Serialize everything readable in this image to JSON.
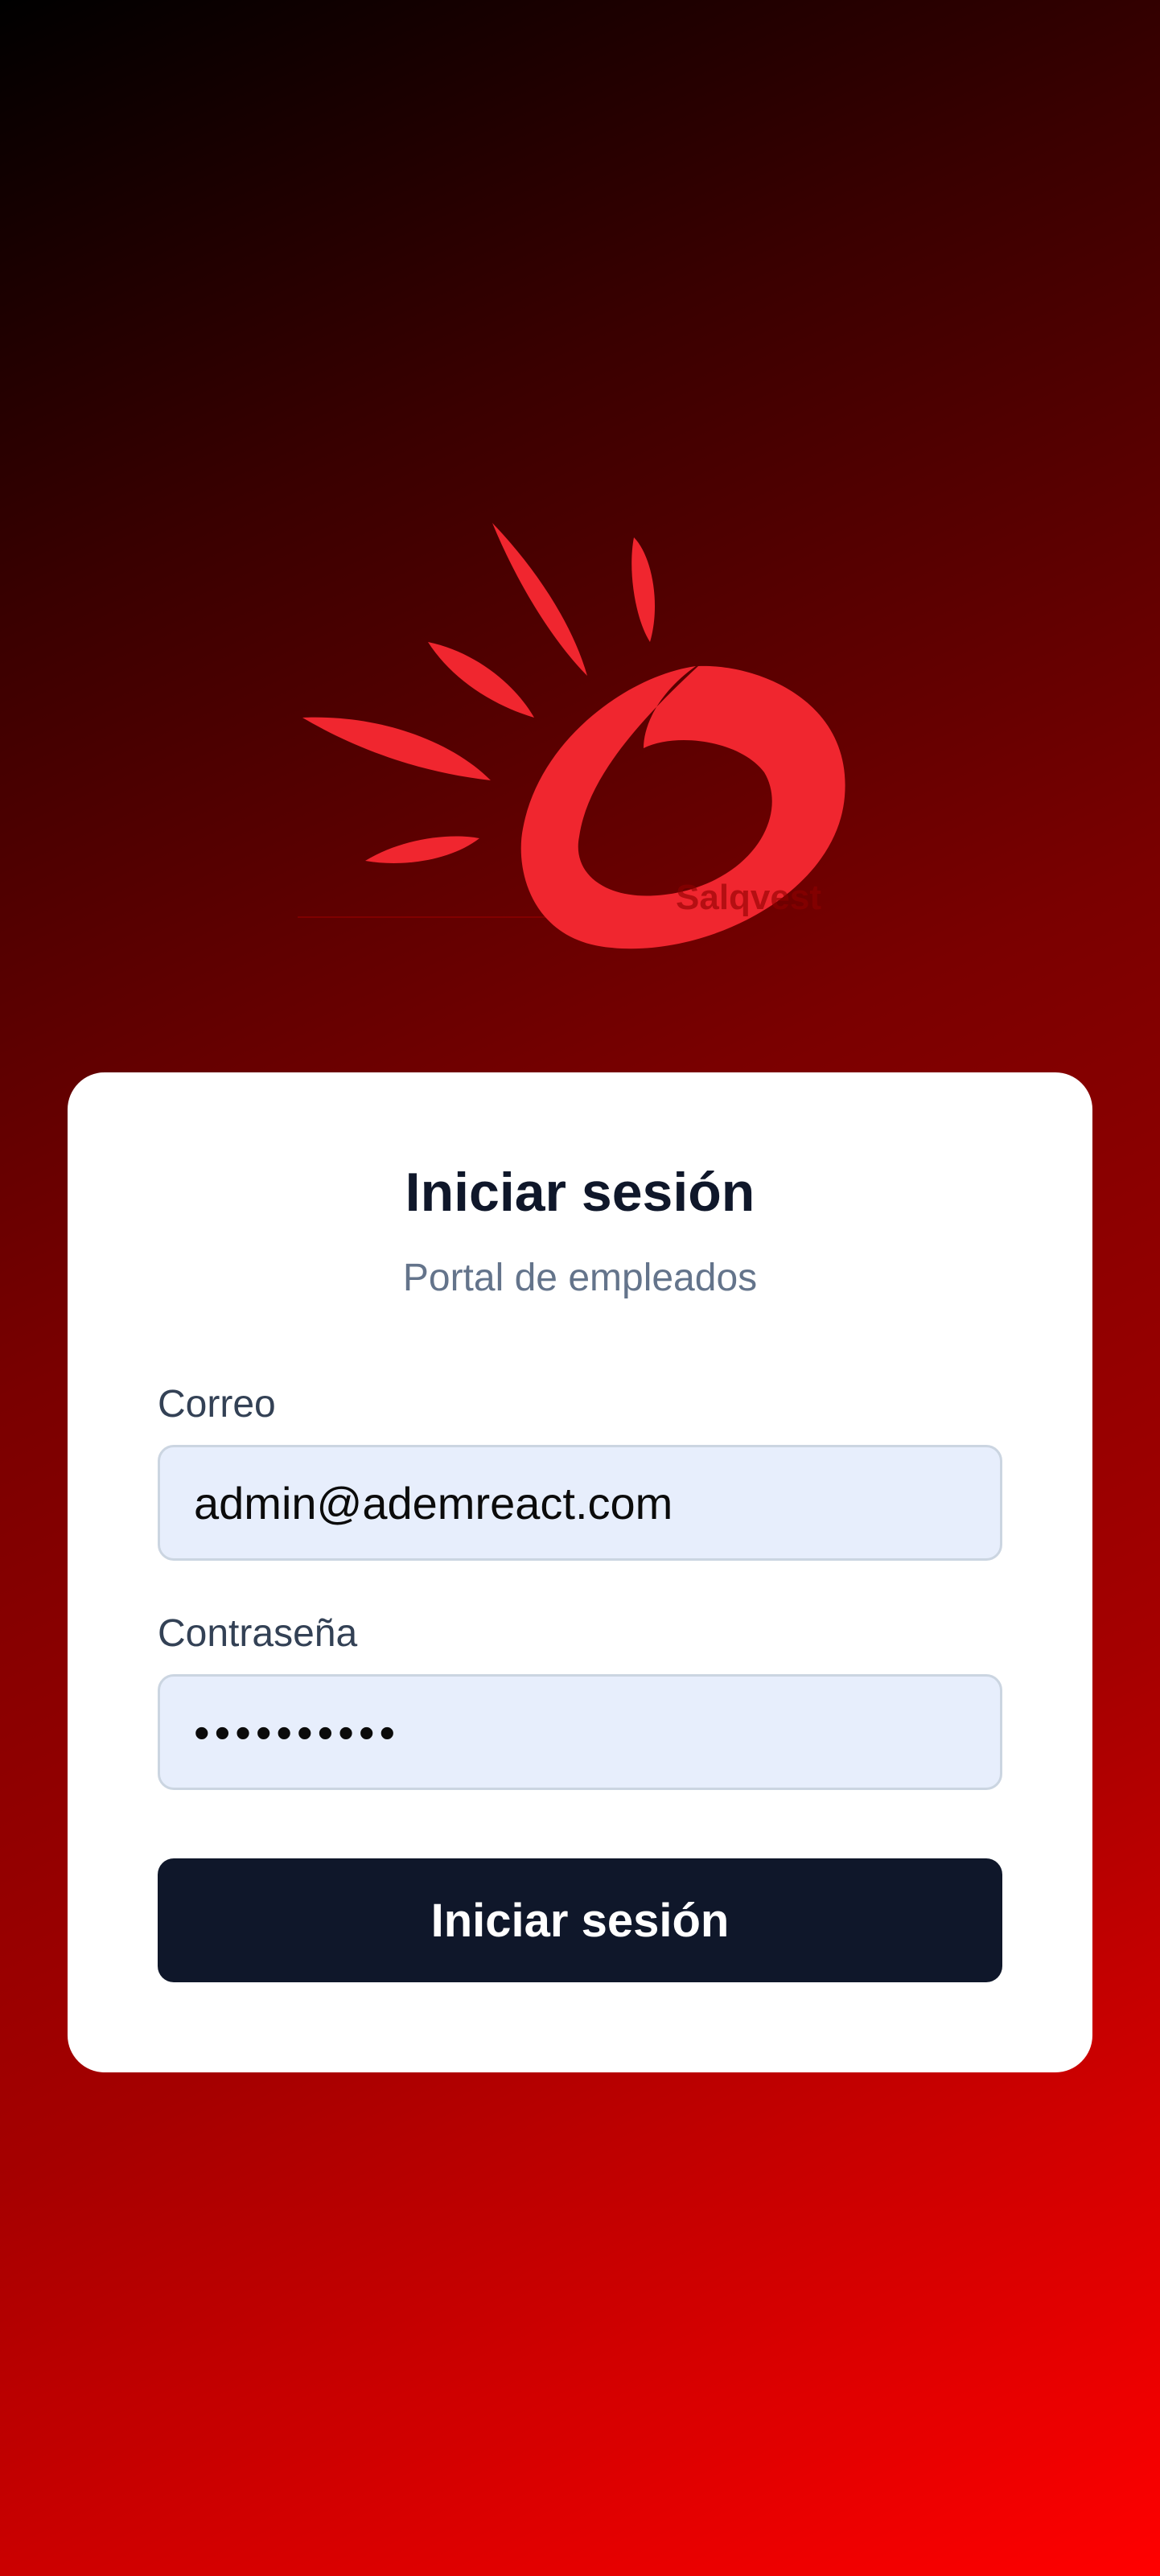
{
  "login": {
    "title": "Iniciar sesión",
    "subtitle": "Portal de empleados",
    "email_label": "Correo",
    "email_value": "admin@ademreact.com",
    "password_label": "Contraseña",
    "password_value": "••••••••••",
    "submit_label": "Iniciar sesión"
  },
  "colors": {
    "brand_red": "#f0262f",
    "button_bg": "#0f172a",
    "input_bg": "#e7eefc"
  }
}
